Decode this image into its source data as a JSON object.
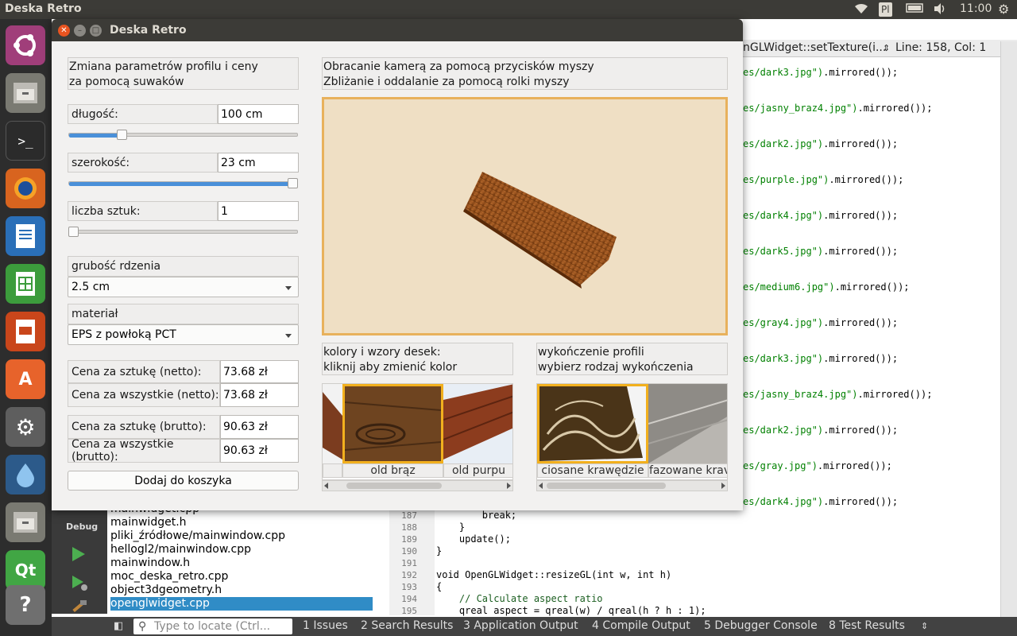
{
  "top_panel": {
    "app_title": "Deska Retro",
    "keyboard_layout": "Pl",
    "time": "11:00"
  },
  "window": {
    "title": "Deska Retro"
  },
  "left_panel": {
    "header_line1": "Zmiana parametrów profilu i ceny",
    "header_line2": "za pomocą suwaków",
    "length_label": "długość:",
    "length_value": "100 cm",
    "length_slider_fraction": 0.22,
    "width_label": "szerokość:",
    "width_value": "23 cm",
    "width_slider_fraction": 1.0,
    "count_label": "liczba sztuk:",
    "count_value": "1",
    "count_slider_fraction": 0.0,
    "core_label": "grubość rdzenia",
    "core_value": "2.5 cm",
    "material_label": "materiał",
    "material_value": "EPS z powłoką PCT",
    "price_unit_net_label": "Cena za sztukę (netto):",
    "price_unit_net_value": "73.68 zł",
    "price_all_net_label": "Cena za wszystkie (netto):",
    "price_all_net_value": "73.68 zł",
    "price_unit_gross_label": "Cena za sztukę (brutto):",
    "price_unit_gross_value": "90.63 zł",
    "price_all_gross_label": "Cena za wszystkie (brutto):",
    "price_all_gross_value": "90.63 zł",
    "add_to_cart": "Dodaj do koszyka"
  },
  "right_panel": {
    "header_line1": "Obracanie kamerą za pomocą przycisków myszy",
    "header_line2": "Zbliżanie i oddalanie za pomocą rolki myszy",
    "colors_line1": "kolory i wzory desek:",
    "colors_line2": "kliknij aby zmienić kolor",
    "finish_line1": "wykończenie profili",
    "finish_line2": "wybierz rodzaj wykończenia",
    "color_thumbs": [
      "",
      "old brąz",
      "old purpu"
    ],
    "finish_thumbs": [
      "ciosane krawędzie",
      "fazowane krav"
    ]
  },
  "editor": {
    "function_combo": "nGLWidget::setTexture(i...",
    "position": "Line: 158, Col: 1",
    "code_lines": [
      {
        "pre": "es/dark3.jpg\")",
        "post": ".mirrored());"
      },
      {
        "pre": "es/jasny_braz4.jpg\")",
        "post": ".mirrored());"
      },
      {
        "pre": "es/dark2.jpg\")",
        "post": ".mirrored());"
      },
      {
        "pre": "es/purple.jpg\")",
        "post": ".mirrored());"
      },
      {
        "pre": "es/dark4.jpg\")",
        "post": ".mirrored());"
      },
      {
        "pre": "es/dark5.jpg\")",
        "post": ".mirrored());"
      },
      {
        "pre": "es/medium6.jpg\")",
        "post": ".mirrored());"
      },
      {
        "pre": "es/gray4.jpg\")",
        "post": ".mirrored());"
      },
      {
        "pre": "es/dark3.jpg\")",
        "post": ".mirrored());"
      },
      {
        "pre": "es/jasny_braz4.jpg\")",
        "post": ".mirrored());"
      },
      {
        "pre": "es/dark2.jpg\")",
        "post": ".mirrored());"
      },
      {
        "pre": "es/gray.jpg\")",
        "post": ".mirrored());"
      },
      {
        "pre": "es/dark4.jpg\")",
        "post": ".mirrored());"
      }
    ],
    "line_numbers": [
      "187",
      "188",
      "189",
      "190",
      "191",
      "192",
      "193",
      "194",
      "195"
    ],
    "bottom_code": [
      "        break;",
      "    }",
      "    update();",
      "}",
      "",
      "void OpenGLWidget::resizeGL(int w, int h)",
      "{",
      "    // Calculate aspect ratio",
      "    qreal aspect = qreal(w) / qreal(h ? h : 1);"
    ]
  },
  "files": {
    "debug_label": "Debug",
    "items": [
      "mainwidget.cpp",
      "mainwidget.h",
      "pliki_źródłowe/mainwindow.cpp",
      "hellogl2/mainwindow.cpp",
      "mainwindow.h",
      "moc_deska_retro.cpp",
      "object3dgeometry.h",
      "openglwidget.cpp"
    ]
  },
  "bottom_bar": {
    "locate_placeholder": "Type to locate (Ctrl...",
    "tabs": [
      "1  Issues",
      "2  Search Results",
      "3  Application Output",
      "4  Compile Output",
      "5  Debugger Console",
      "8  Test Results"
    ]
  },
  "colors": {
    "accent_highlight": "#e8b15c",
    "selection_blue": "#308cc6",
    "panel_dark": "#3c3b37"
  }
}
